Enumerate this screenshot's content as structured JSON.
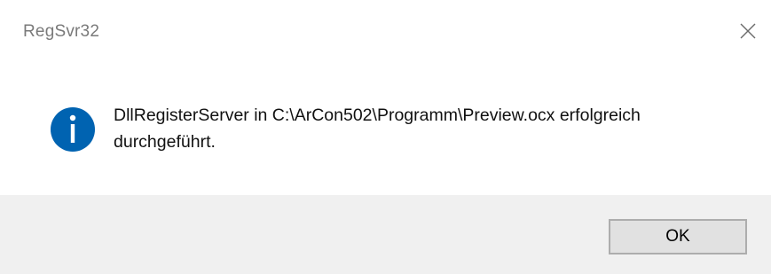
{
  "window": {
    "title": "RegSvr32",
    "close_icon": "close-icon"
  },
  "message": {
    "icon": "info-icon",
    "icon_color": "#0063b1",
    "text": "DllRegisterServer in C:\\ArCon502\\Programm\\Preview.ocx erfolgreich durchgeführt."
  },
  "footer": {
    "ok_label": "OK"
  }
}
